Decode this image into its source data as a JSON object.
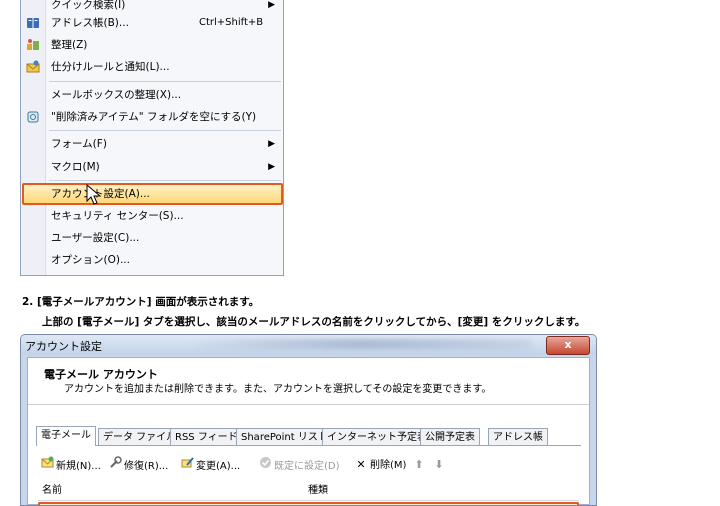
{
  "menu": {
    "items": [
      {
        "label": "クイック検索(I)",
        "icon": "",
        "arrow": "▶"
      },
      {
        "label": "アドレス帳(B)...",
        "shortcut": "Ctrl+Shift+B",
        "icon": "address-book-icon"
      },
      {
        "label": "整理(Z)",
        "icon": "organize-icon"
      },
      {
        "label": "仕分けルールと通知(L)...",
        "icon": "rules-icon"
      },
      {
        "label": "メールボックスの整理(X)...",
        "icon": ""
      },
      {
        "label": "\"削除済みアイテム\" フォルダを空にする(Y)",
        "icon": "empty-trash-icon"
      },
      {
        "label": "フォーム(F)",
        "arrow": "▶"
      },
      {
        "label": "マクロ(M)",
        "arrow": "▶"
      },
      {
        "label": "アカウント設定(A)...",
        "highlighted": true
      },
      {
        "label": "セキュリティ センター(S)..."
      },
      {
        "label": "ユーザー設定(C)..."
      },
      {
        "label": "オプション(O)..."
      }
    ]
  },
  "instructions": {
    "step": "2. [電子メールアカウント] 画面が表示されます。",
    "detail": "上部の [電子メール] タブを選択し、該当のメールアドレスの名前をクリックしてから、[変更] をクリックします。"
  },
  "dialog": {
    "title": "アカウント設定",
    "close_label": "x",
    "header_title": "電子メール アカウント",
    "header_desc": "アカウントを追加または削除できます。また、アカウントを選択してその設定を変更できます。",
    "tabs": [
      "電子メール",
      "データ ファイル",
      "RSS フィード",
      "SharePoint リスト",
      "インターネット予定表",
      "公開予定表",
      "アドレス帳"
    ],
    "toolbar": {
      "new": "新規(N)...",
      "repair": "修復(R)...",
      "change": "変更(A)...",
      "default": "既定に設定(D)",
      "delete": "削除(M)",
      "up": "⬆",
      "down": "⬇"
    },
    "columns": {
      "name": "名前",
      "type": "種類"
    }
  },
  "colors": {
    "highlight_border": "#e05a22",
    "highlight_fill": "#ffd87a"
  }
}
